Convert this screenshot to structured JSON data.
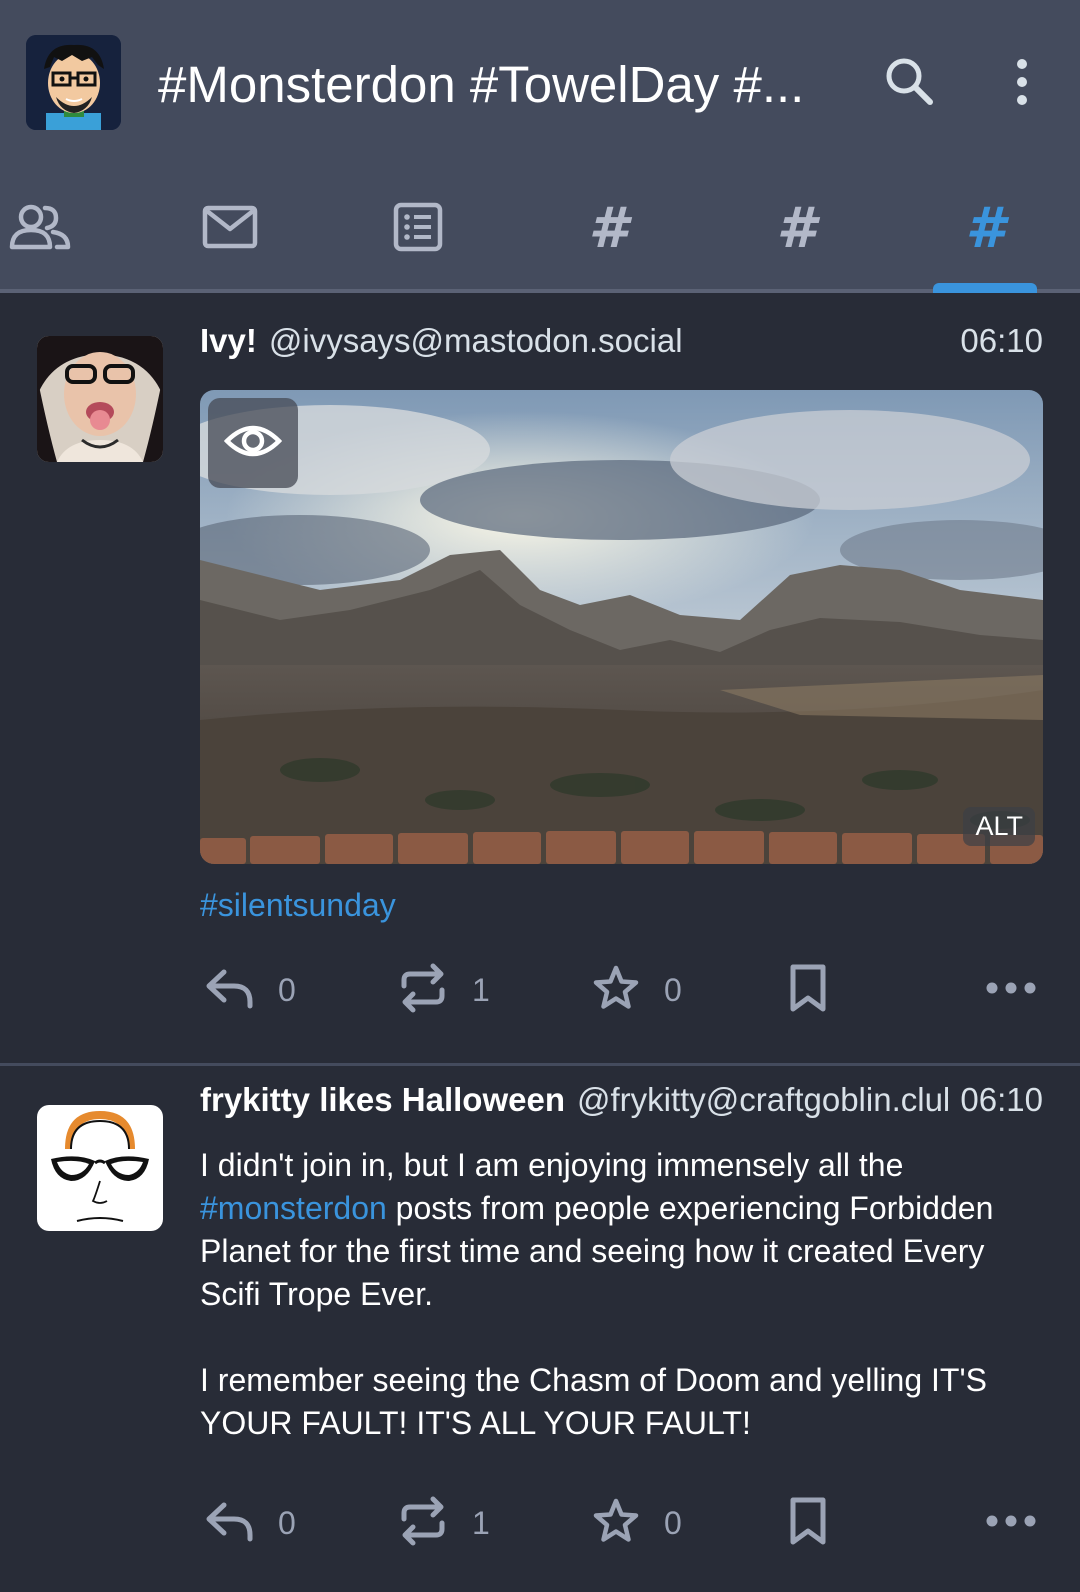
{
  "header": {
    "title": "#Monsterdon #TowelDay #...",
    "search_icon": "search-icon",
    "menu_icon": "more-vertical-icon"
  },
  "tabs": [
    {
      "icon": "people-icon",
      "label": ""
    },
    {
      "icon": "mail-icon",
      "label": ""
    },
    {
      "icon": "list-icon",
      "label": ""
    },
    {
      "icon": "hashtag-icon",
      "label": "#"
    },
    {
      "icon": "hashtag-icon",
      "label": "#"
    },
    {
      "icon": "hashtag-icon",
      "label": "#",
      "active": true
    }
  ],
  "colors": {
    "accent": "#3a94dd",
    "background": "#282c37",
    "header": "#444b5d"
  },
  "posts": [
    {
      "display_name": "Ivy!",
      "handle": "@ivysays@mastodon.social",
      "time": "06:10",
      "media_alt_badge": "ALT",
      "hashtag": "#silentsunday",
      "replies": "0",
      "boosts": "1",
      "favourites": "0"
    },
    {
      "display_name": "frykitty likes Halloween",
      "handle": "@frykitty@craftgoblin.club",
      "time": "06:10",
      "text_before_tag": "I didn't join in, but I am enjoying immensely all the ",
      "hashtag": "#monsterdon",
      "text_after_tag": " posts from people experiencing Forbidden Planet for the first time and seeing how it created Every Scifi Trope Ever.",
      "paragraph2": "I remember seeing the Chasm of Doom and yelling IT'S YOUR FAULT! IT'S ALL YOUR FAULT!",
      "replies": "0",
      "boosts": "1",
      "favourites": "0"
    }
  ]
}
